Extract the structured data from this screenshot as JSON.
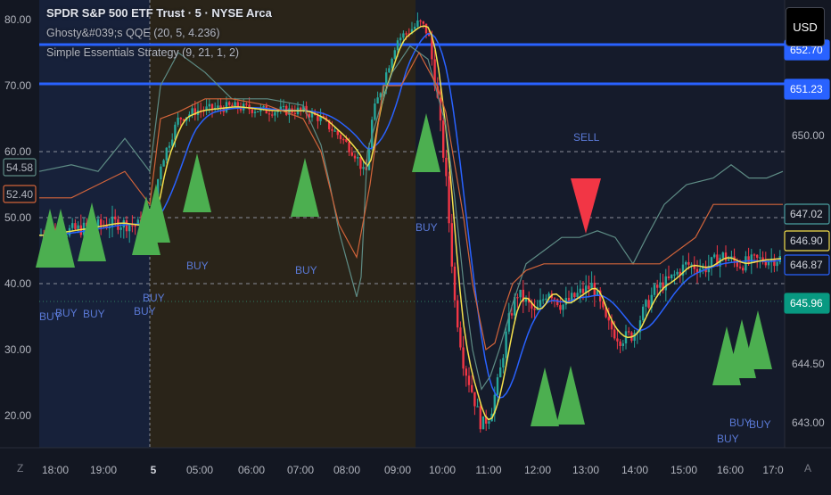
{
  "legend": {
    "symbol": "SPDR S&P 500 ETF Trust · 5 · NYSE Arca",
    "indicator_1": "Ghosty&#039;s QQE (20, 5, 4.236)",
    "indicator_2": "Simple Essentials Strategy (9, 21, 1, 2)"
  },
  "currency_button": "USD",
  "corner": {
    "left": "Z",
    "right": "A"
  },
  "colors": {
    "background": "#131722",
    "session_shade": "#2a2419",
    "premarket_shade": "#17213a",
    "bull_candle": "#26a69a",
    "bear_candle": "#f23645",
    "buy_marker": "#4caf50",
    "sell_marker": "#f23645",
    "level_line": "#2962ff",
    "qqe_line": "#5e8c85",
    "slow_line": "#d2643a",
    "ma_fast": "#f5e04c",
    "ma_slow": "#2962ff"
  },
  "chart_data": {
    "type": "candlestick",
    "left_axis": {
      "ticks": [
        "80.00",
        "70.00",
        "60.00",
        "50.00",
        "40.00",
        "30.00",
        "20.00"
      ]
    },
    "right_axis": {
      "ticks": [
        "650.00",
        "644.50",
        "643.00"
      ],
      "price_tags": [
        {
          "value": "652.70",
          "tag": "652.70",
          "color": "#2962ff"
        },
        {
          "value": "651.23",
          "tag": "651.23",
          "color": "#2962ff"
        },
        {
          "value": "647.02",
          "tag": "647.02",
          "color": "#4a9ea0"
        },
        {
          "value": "646.90",
          "tag": "646.90",
          "color": "#f5e04c"
        },
        {
          "value": "646.87",
          "tag": "646.87",
          "color": "#2962ff"
        },
        {
          "value": "645.96",
          "tag": "645.96",
          "color": "#089981"
        }
      ]
    },
    "left_tags": [
      {
        "label": "54.58",
        "color": "#5e8c85"
      },
      {
        "label": "52.40",
        "color": "#d2643a"
      }
    ],
    "x_ticks": [
      "18:00",
      "19:00",
      "5",
      "05:00",
      "06:00",
      "07:00",
      "08:00",
      "09:00",
      "10:00",
      "11:00",
      "12:00",
      "13:00",
      "14:00",
      "15:00",
      "16:00",
      "17:0"
    ],
    "buy_labels": [
      "BUY",
      "BUY",
      "BUY",
      "BUY",
      "BUY",
      "BUY",
      "BUY",
      "BUY",
      "BUY",
      "BUY",
      "BUY"
    ],
    "sell_labels": [
      "SELL"
    ]
  }
}
